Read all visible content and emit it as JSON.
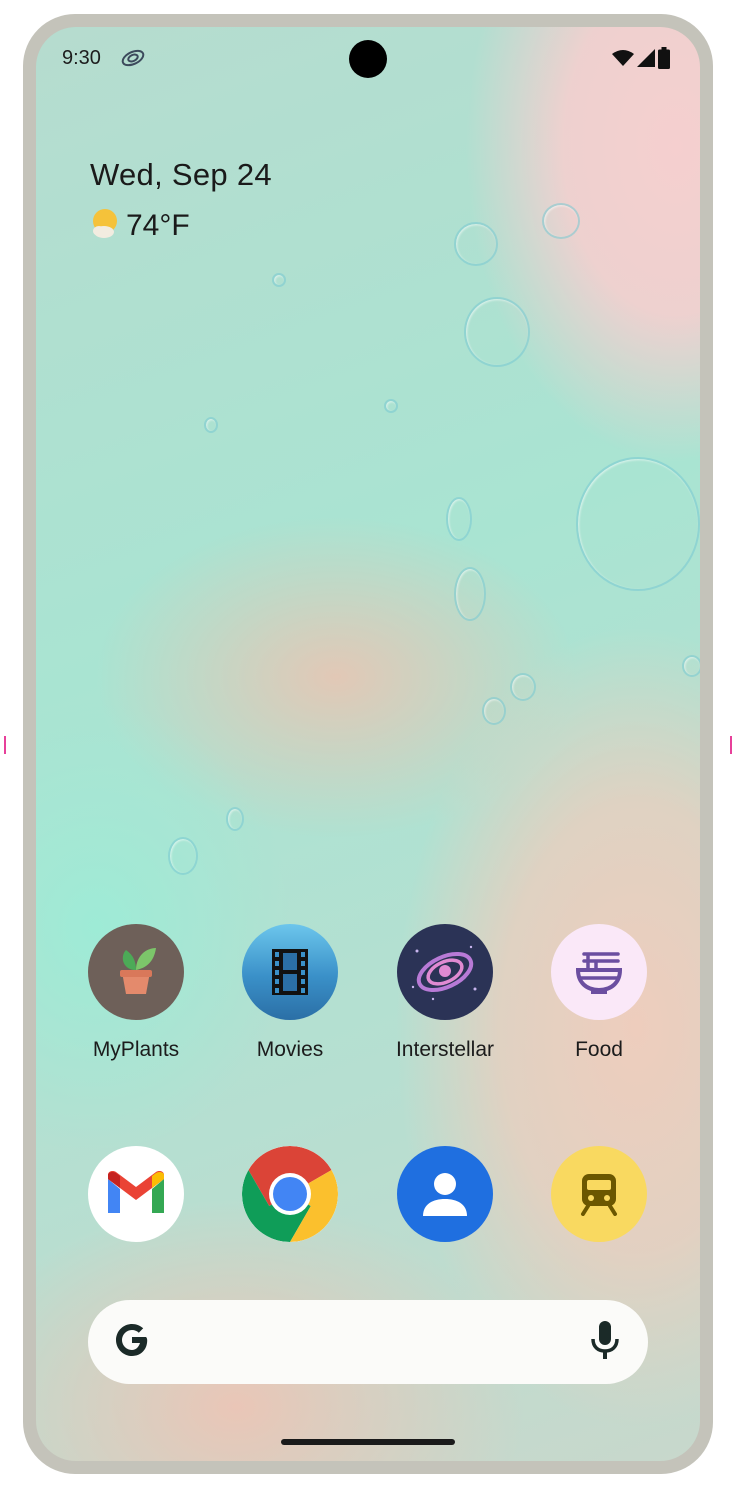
{
  "status_bar": {
    "time": "9:30",
    "app_icon": "galaxy-swirl-icon",
    "right_icons": [
      "wifi-icon",
      "signal-icon",
      "battery-icon"
    ]
  },
  "at_a_glance": {
    "date": "Wed, Sep 24",
    "weather_icon": "sun-cloud-icon",
    "temperature": "74°F"
  },
  "apps": [
    {
      "label": "MyPlants",
      "icon": "potted-plant-icon",
      "background": "#6e6059"
    },
    {
      "label": "Movies",
      "icon": "film-strip-icon",
      "background": "#3a90c8"
    },
    {
      "label": "Interstellar",
      "icon": "galaxy-icon",
      "background": "#2b3356"
    },
    {
      "label": "Food",
      "icon": "noodle-bowl-icon",
      "background": "#fae8f8"
    }
  ],
  "dock": [
    {
      "name": "Gmail",
      "icon": "gmail-icon"
    },
    {
      "name": "Chrome",
      "icon": "chrome-icon"
    },
    {
      "name": "Contacts",
      "icon": "contacts-icon"
    },
    {
      "name": "Transit",
      "icon": "train-icon"
    }
  ],
  "search": {
    "logo": "google-g-icon",
    "mic": "microphone-icon"
  },
  "colors": {
    "frame": "#c4c3ba",
    "wallpaper_mint": "#a9e4d2",
    "wallpaper_pink": "#f5cfcf"
  }
}
